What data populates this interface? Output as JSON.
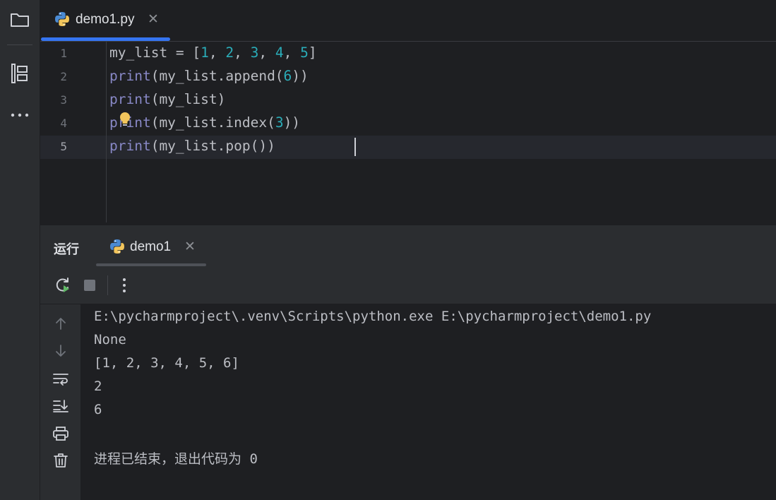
{
  "activity_bar": {
    "items": [
      {
        "icon": "folder-icon"
      },
      {
        "icon": "structure-icon"
      },
      {
        "icon": "more-horizontal-icon"
      }
    ]
  },
  "editor": {
    "tab": {
      "label": "demo1.py",
      "icon": "python-icon",
      "close": "✕"
    },
    "lines": [
      {
        "num": "1",
        "tokens": [
          {
            "t": "my_list = [",
            "c": "plain"
          },
          {
            "t": "1",
            "c": "num"
          },
          {
            "t": ", ",
            "c": "plain"
          },
          {
            "t": "2",
            "c": "num"
          },
          {
            "t": ", ",
            "c": "plain"
          },
          {
            "t": "3",
            "c": "num"
          },
          {
            "t": ", ",
            "c": "plain"
          },
          {
            "t": "4",
            "c": "num"
          },
          {
            "t": ", ",
            "c": "plain"
          },
          {
            "t": "5",
            "c": "num"
          },
          {
            "t": "]",
            "c": "plain"
          }
        ]
      },
      {
        "num": "2",
        "tokens": [
          {
            "t": "print",
            "c": "fn"
          },
          {
            "t": "(my_list.append(",
            "c": "plain"
          },
          {
            "t": "6",
            "c": "num"
          },
          {
            "t": "))",
            "c": "plain"
          }
        ]
      },
      {
        "num": "3",
        "tokens": [
          {
            "t": "print",
            "c": "fn"
          },
          {
            "t": "(my_list)",
            "c": "plain"
          }
        ]
      },
      {
        "num": "4",
        "tokens": [
          {
            "t": "print",
            "c": "fn"
          },
          {
            "t": "(my_list.index(",
            "c": "plain"
          },
          {
            "t": "3",
            "c": "num"
          },
          {
            "t": "))",
            "c": "plain"
          }
        ]
      },
      {
        "num": "5",
        "tokens": [
          {
            "t": "print",
            "c": "fn"
          },
          {
            "t": "(my_list.pop())",
            "c": "plain"
          }
        ]
      }
    ],
    "active_line": "5"
  },
  "run_panel": {
    "title": "运行",
    "tab": {
      "label": "demo1",
      "icon": "python-icon",
      "close": "✕"
    },
    "toolbar": [
      {
        "icon": "rerun-icon"
      },
      {
        "icon": "stop-icon"
      },
      {
        "icon": "more-vertical-icon"
      }
    ],
    "side_toolbar": [
      {
        "icon": "arrow-up-icon"
      },
      {
        "icon": "arrow-down-icon"
      },
      {
        "icon": "soft-wrap-icon"
      },
      {
        "icon": "scroll-to-end-icon"
      },
      {
        "icon": "print-icon"
      },
      {
        "icon": "trash-icon"
      }
    ],
    "output": [
      "E:\\pycharmproject\\.venv\\Scripts\\python.exe E:\\pycharmproject\\demo1.py",
      "None",
      "[1, 2, 3, 4, 5, 6]",
      "2",
      "6",
      "",
      "进程已结束，退出代码为 0"
    ]
  },
  "colors": {
    "accent": "#3574f0",
    "function": "#8888c6",
    "number": "#2aacb8",
    "text": "#bcbec4",
    "bulb": "#f2c55c"
  }
}
